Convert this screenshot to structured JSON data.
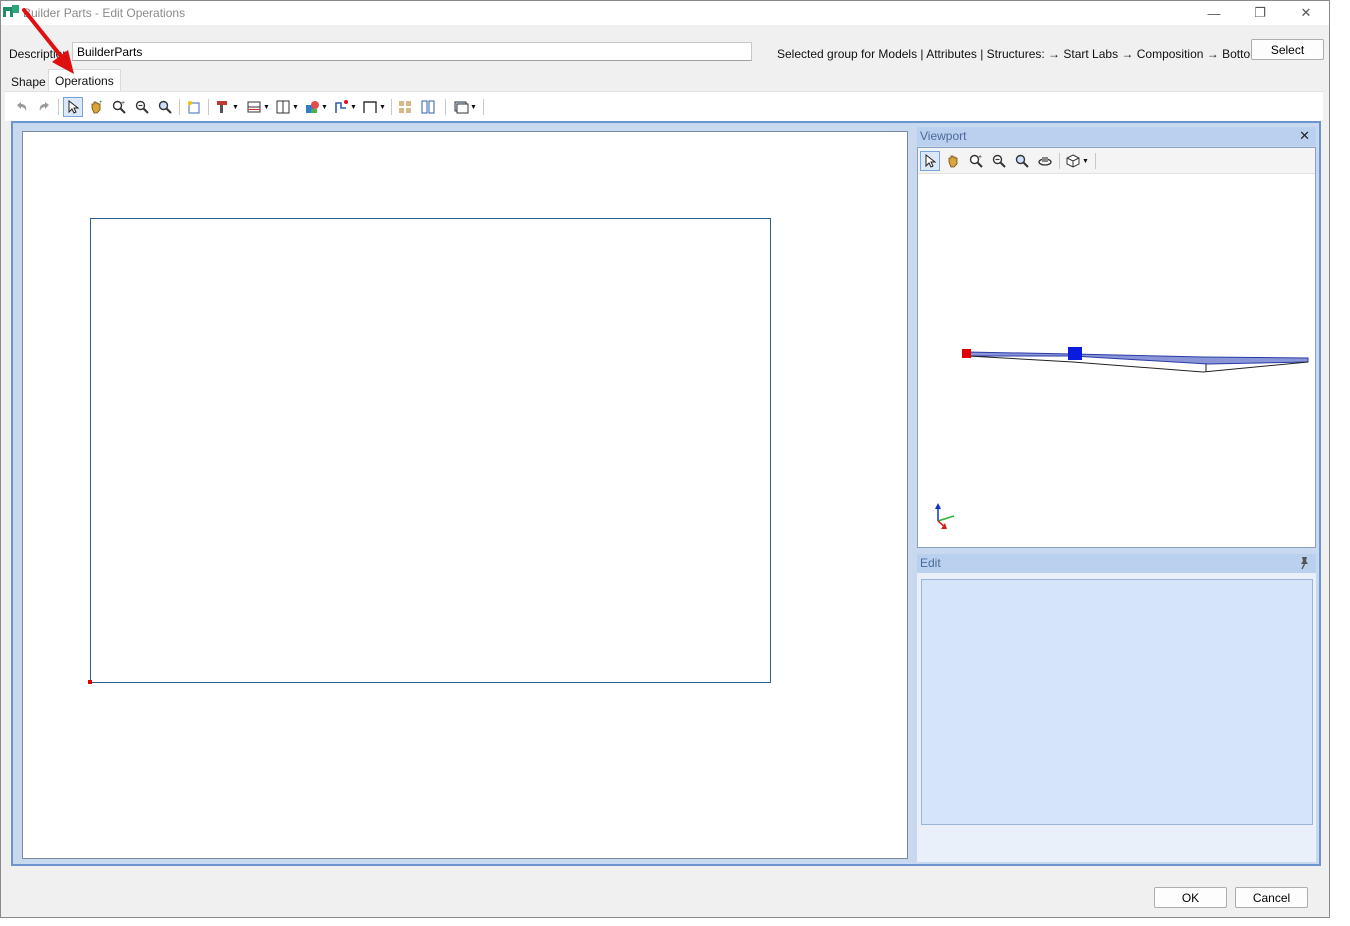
{
  "window": {
    "title": "Builder Parts - Edit Operations",
    "min_glyph": "—",
    "max_glyph": "❐",
    "close_glyph": "✕"
  },
  "description": {
    "label": "Description",
    "value": "BuilderParts"
  },
  "selected_group_text": "Selected group for Models | Attributes | Structures:  → Start Labs → Composition → Bottoms",
  "select_button": "Select",
  "tabs": [
    {
      "label": "Shape",
      "active": false
    },
    {
      "label": "Operations",
      "active": true
    }
  ],
  "toolbar_icons": [
    "undo-icon",
    "redo-icon",
    "pointer-icon",
    "pan-hand-icon",
    "zoom-in-icon",
    "zoom-out-icon",
    "zoom-extents-icon",
    "new-sketch-icon",
    "drill-tool-icon",
    "horizontal-split-icon",
    "vertical-split-icon",
    "paint-tool-icon",
    "path-tool-icon",
    "frame-tool-icon",
    "group-icon",
    "align-icon",
    "display-options-icon"
  ],
  "viewport": {
    "title": "Viewport",
    "close_glyph": "✕",
    "toolbar_icons": [
      "pointer-icon",
      "pan-hand-icon",
      "zoom-in-icon",
      "zoom-out-icon",
      "zoom-extents-icon",
      "orbit-icon",
      "view-cube-icon"
    ]
  },
  "edit_panel": {
    "title": "Edit"
  },
  "buttons": {
    "ok": "OK",
    "cancel": "Cancel"
  },
  "colors": {
    "frame_border": "#6c95cf",
    "panel_header": "#b9d0ee",
    "annotation_arrow": "#e01010",
    "selection_point": "#e00000",
    "viewport_handle": "#0a1adf"
  }
}
